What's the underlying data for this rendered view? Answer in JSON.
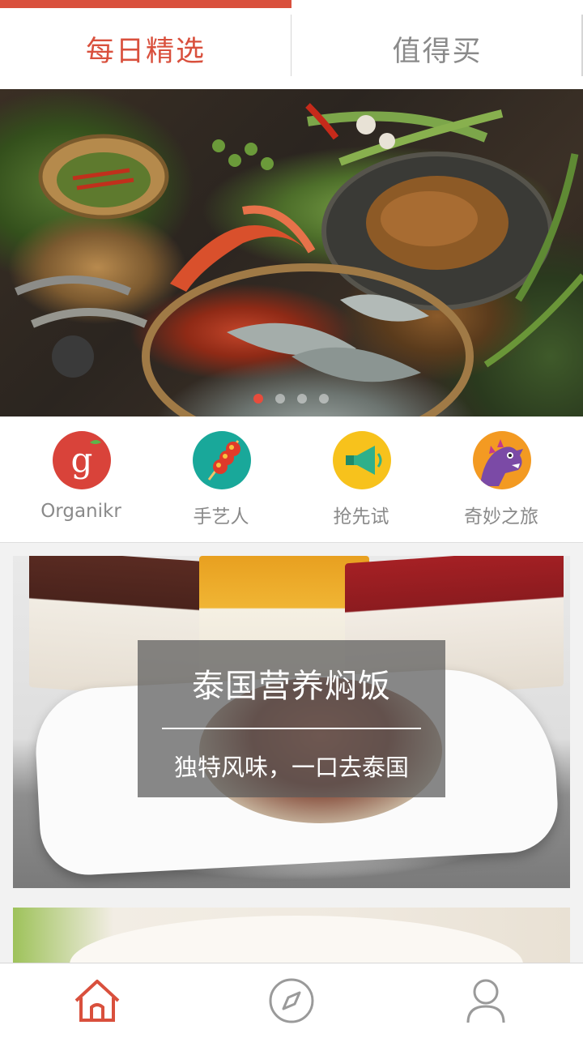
{
  "tabs": {
    "daily_picks": "每日精选",
    "worth_buying": "值得买"
  },
  "banner": {
    "dot_count": 4,
    "active_dot": 0
  },
  "categories": [
    {
      "label": "Organikr",
      "icon": "organikr-g-icon",
      "color": "#d9433a"
    },
    {
      "label": "手艺人",
      "icon": "candied-hawthorn-icon",
      "color": "#19a89a"
    },
    {
      "label": "抢先试",
      "icon": "megaphone-icon",
      "color": "#f7c21c"
    },
    {
      "label": "奇妙之旅",
      "icon": "purple-monster-icon",
      "color": "#f39a22"
    }
  ],
  "feature": {
    "title": "泰国营养焖饭",
    "subtitle": "独特风味，一口去泰国"
  },
  "bottom_nav": {
    "items": [
      "home-icon",
      "compass-icon",
      "user-icon"
    ],
    "active": 0
  },
  "colors": {
    "accent": "#d9503d",
    "inactive": "#8a8a8a"
  }
}
